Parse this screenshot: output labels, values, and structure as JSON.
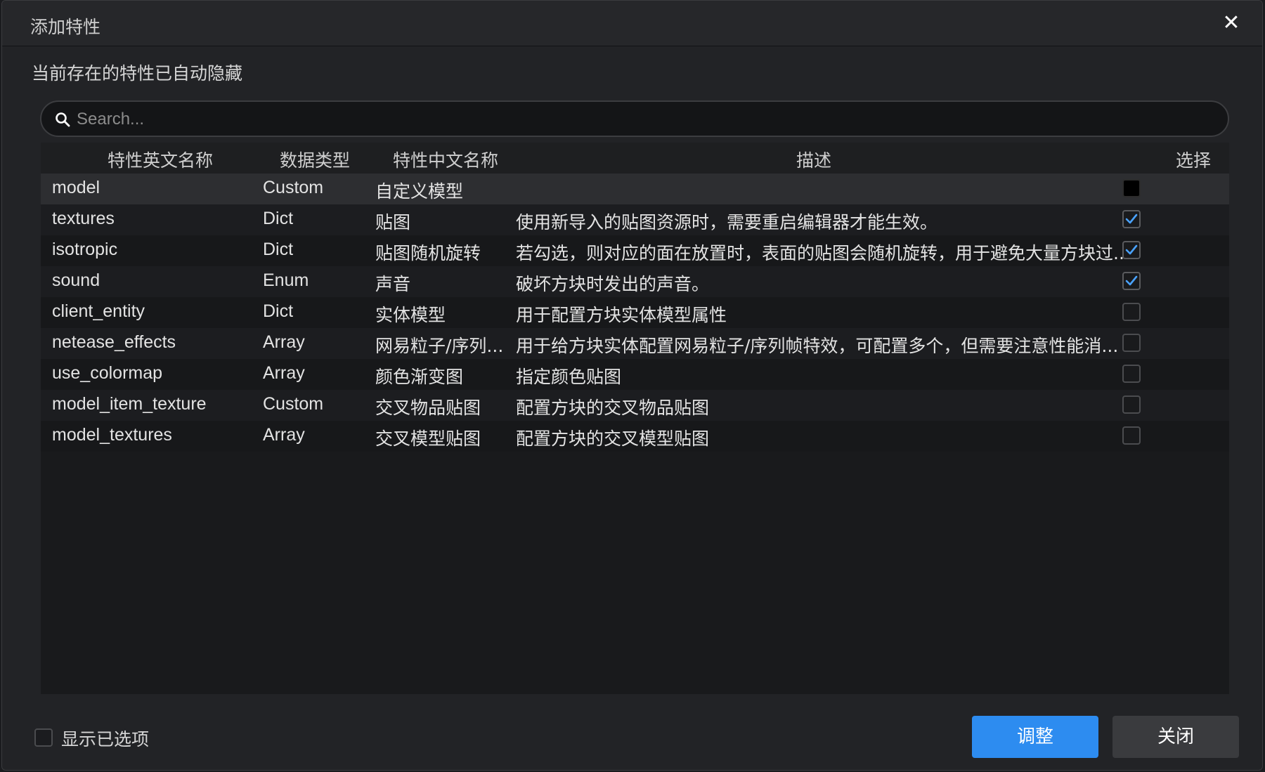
{
  "dialog": {
    "title": "添加特性",
    "close_glyph": "✕",
    "notice": "当前存在的特性已自动隐藏"
  },
  "search": {
    "placeholder": "Search...",
    "value": ""
  },
  "table": {
    "headers": {
      "name_en": "特性英文名称",
      "data_type": "数据类型",
      "name_cn": "特性中文名称",
      "description": "描述",
      "select": "选择"
    },
    "rows": [
      {
        "name_en": "model",
        "data_type": "Custom",
        "name_cn": "自定义模型",
        "description": "",
        "checked": false
      },
      {
        "name_en": "textures",
        "data_type": "Dict",
        "name_cn": "贴图",
        "description": "使用新导入的贴图资源时，需要重启编辑器才能生效。",
        "checked": true
      },
      {
        "name_en": "isotropic",
        "data_type": "Dict",
        "name_cn": "贴图随机旋转",
        "description": "若勾选，则对应的面在放置时，表面的贴图会随机旋转，用于避免大量方块过...",
        "checked": true
      },
      {
        "name_en": "sound",
        "data_type": "Enum",
        "name_cn": "声音",
        "description": "破坏方块时发出的声音。",
        "checked": true
      },
      {
        "name_en": "client_entity",
        "data_type": "Dict",
        "name_cn": "实体模型",
        "description": "用于配置方块实体模型属性",
        "checked": false
      },
      {
        "name_en": "netease_effects",
        "data_type": "Array",
        "name_cn": "网易粒子/序列...",
        "description": "用于给方块实体配置网易粒子/序列帧特效，可配置多个，但需要注意性能消...",
        "checked": false
      },
      {
        "name_en": "use_colormap",
        "data_type": "Array",
        "name_cn": "颜色渐变图",
        "description": "指定颜色贴图",
        "checked": false
      },
      {
        "name_en": "model_item_texture",
        "data_type": "Custom",
        "name_cn": "交叉物品贴图",
        "description": "配置方块的交叉物品贴图",
        "checked": false
      },
      {
        "name_en": "model_textures",
        "data_type": "Array",
        "name_cn": "交叉模型贴图",
        "description": "配置方块的交叉模型贴图",
        "checked": false
      }
    ]
  },
  "footer": {
    "show_selected_label": "显示已选项",
    "show_selected_checked": false,
    "adjust_label": "调整",
    "close_label": "关闭"
  },
  "colors": {
    "accent": "#2d8cf0",
    "check": "#4aa3ff",
    "background": "#222326"
  }
}
